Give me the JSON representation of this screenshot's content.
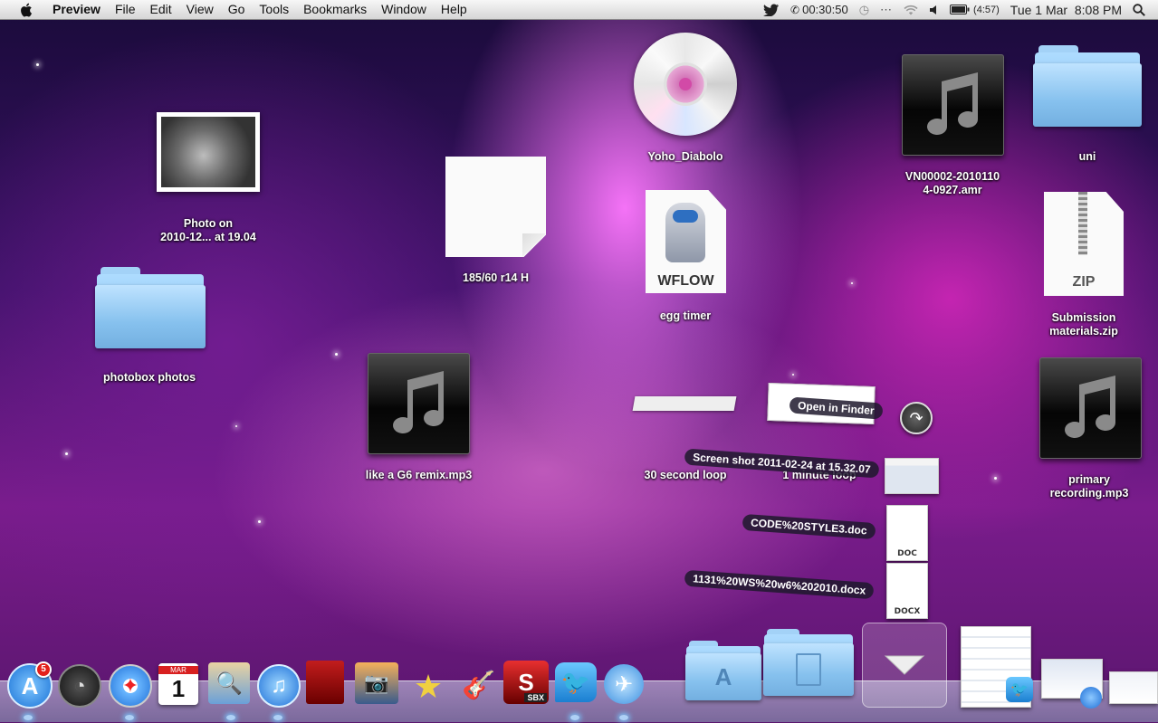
{
  "menubar": {
    "app_name": "Preview",
    "menus": [
      "File",
      "Edit",
      "View",
      "Go",
      "Tools",
      "Bookmarks",
      "Window",
      "Help"
    ],
    "status": {
      "call_timer": "00:30:50",
      "battery_time": "(4:57)",
      "datetime": "Tue 1 Mar  8:08 PM"
    }
  },
  "desktop": {
    "photo_label_1": "Photo on",
    "photo_label_2": "2010-12... at 19.04",
    "photobox_label": "photobox photos",
    "note_label": "185/60 r14 H",
    "cd_label": "Yoho_Diabolo",
    "workflow_label": "egg timer",
    "workflow_badge": "WFLOW",
    "amr_label_1": "VN00002-2010110",
    "amr_label_2": "4-0927.amr",
    "uni_label": "uni",
    "zip_label_1": "Submission",
    "zip_label_2": "materials.zip",
    "zip_badge": "ZIP",
    "mp3_label": "like a G6 remix.mp3",
    "primary_label_1": "primary",
    "primary_label_2": "recording.mp3",
    "loop30_label": "30 second loop",
    "loop1_label": "1 minute loop"
  },
  "stack": {
    "open_in_finder": "Open in Finder",
    "items": [
      {
        "label": "Screen shot 2011-02-24 at 15.32.07",
        "type": ""
      },
      {
        "label": "CODE%20STYLE3.doc",
        "type": "DOC"
      },
      {
        "label": "1131%20WS%20w6%202010.docx",
        "type": "DOCX"
      }
    ]
  },
  "dock": {
    "app_store_badge": "5",
    "calendar_month": "MAR",
    "calendar_day": "1",
    "sbx_label": "SBX"
  },
  "colors": {
    "menubar": "#e8e8e8",
    "folder": "#8cc6f0",
    "badge": "#e3201b"
  }
}
